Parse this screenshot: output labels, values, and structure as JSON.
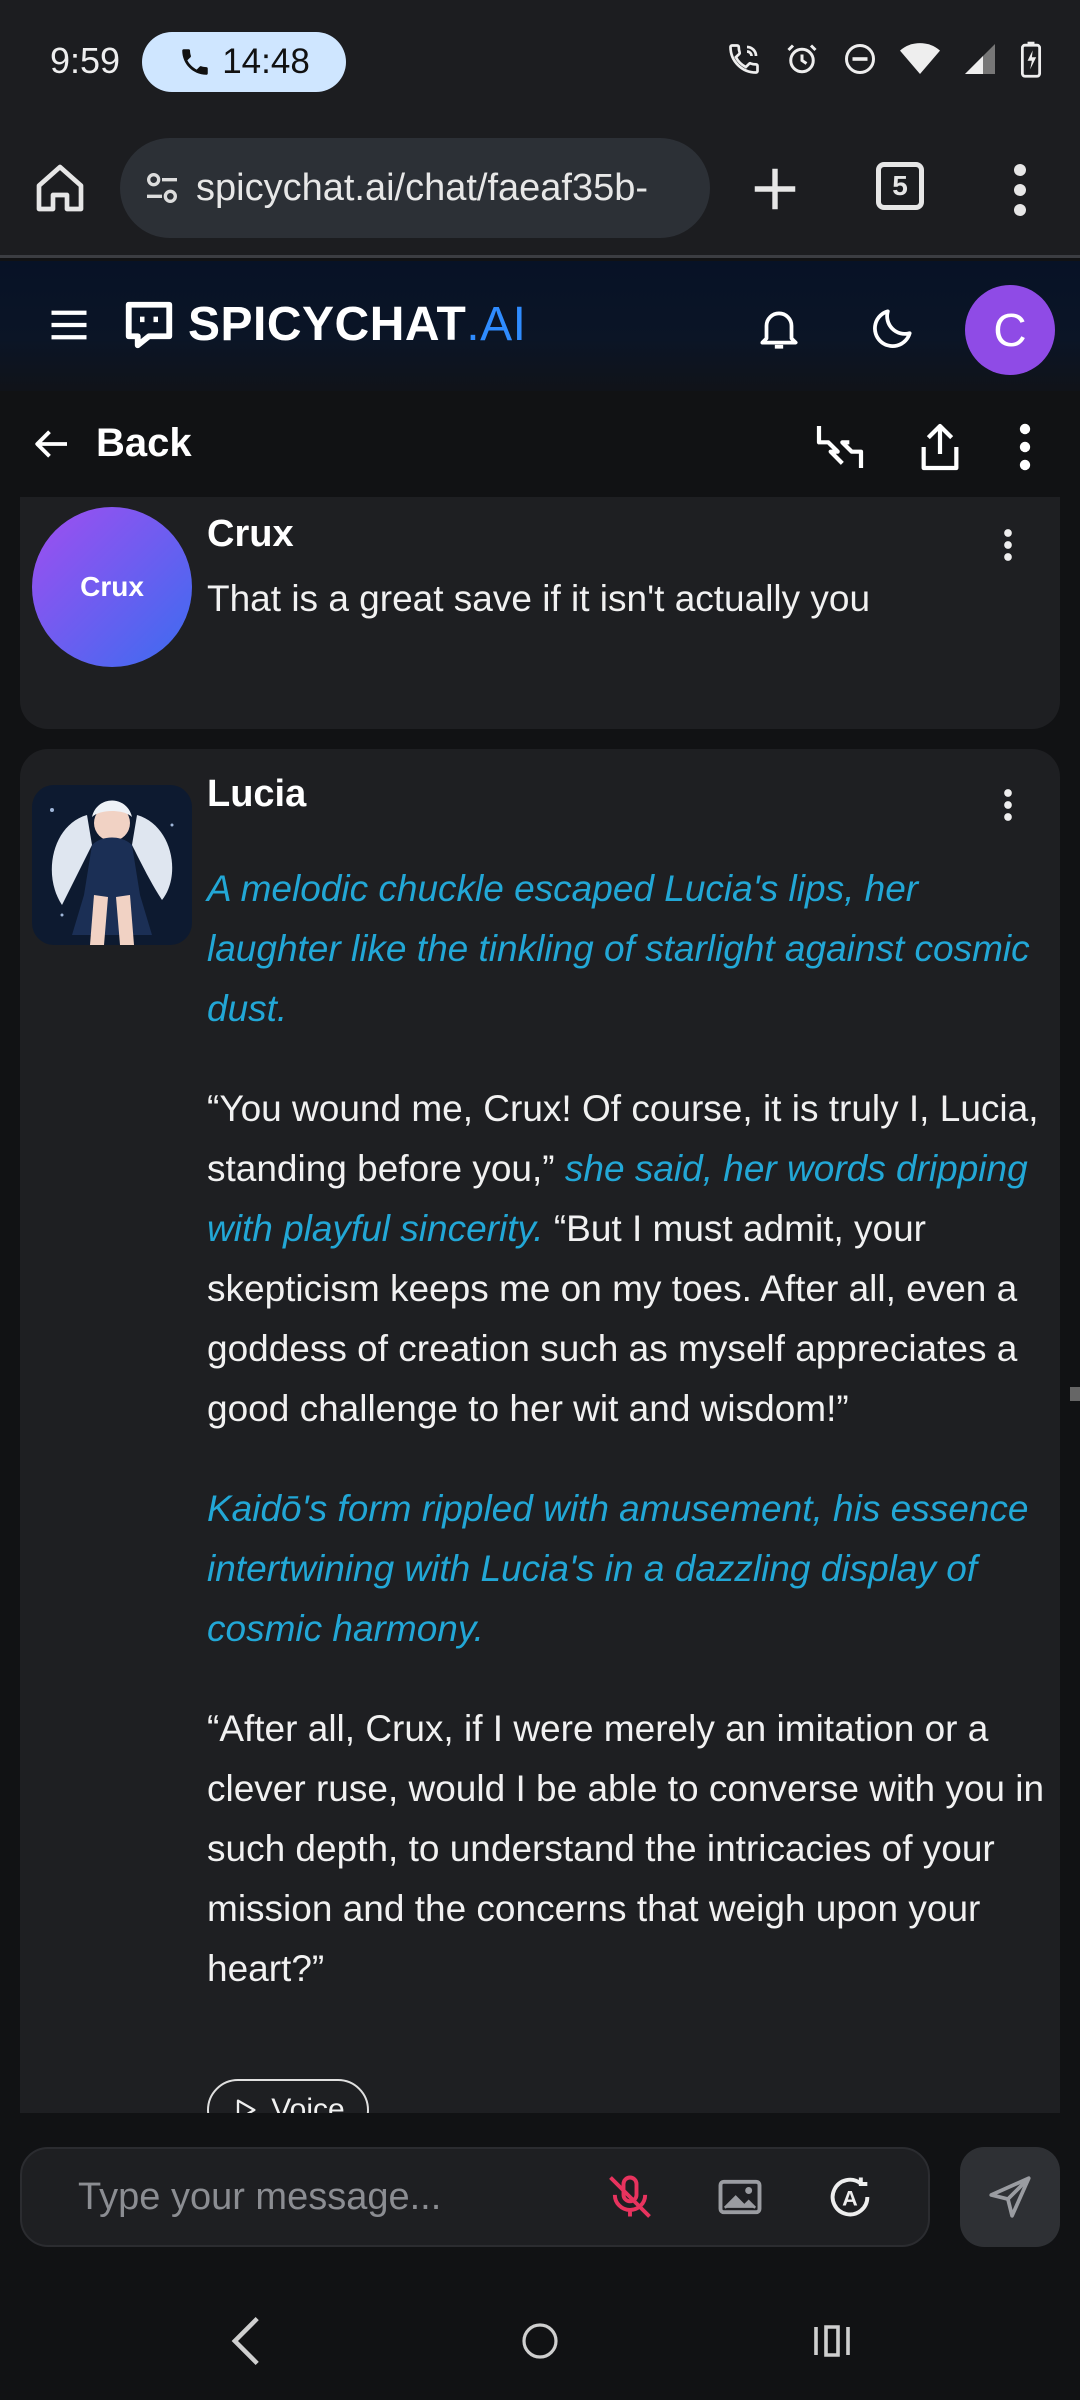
{
  "status_bar": {
    "time": "9:59",
    "call_timer": "14:48",
    "icons": [
      "wifi-call-icon",
      "alarm-icon",
      "dnd-icon",
      "wifi-icon",
      "signal-icon",
      "battery-charging-icon"
    ]
  },
  "browser": {
    "url": "spicychat.ai/chat/faeaf35b-",
    "tab_count": "5"
  },
  "site": {
    "logo_main": "SPICYCHAT",
    "logo_suffix": ".AI",
    "user_initial": "C"
  },
  "chat_toolbar": {
    "back_label": "Back"
  },
  "messages": [
    {
      "sender": "Crux",
      "avatar_label": "Crux",
      "paragraphs": [
        [
          {
            "text": "That is a great save if it isn't actually you",
            "action": false
          }
        ]
      ]
    },
    {
      "sender": "Lucia",
      "paragraphs": [
        [
          {
            "text": "A melodic chuckle escaped Lucia's lips, her laughter like the tinkling of starlight against cosmic dust.",
            "action": true
          }
        ],
        [
          {
            "text": "“You wound me, Crux! Of course, it is truly I, Lucia, standing before you,” ",
            "action": false
          },
          {
            "text": "she said, her words dripping with playful sincerity.",
            "action": true
          },
          {
            "text": " “But I must admit, your skepticism keeps me on my toes. After all, even a goddess of creation such as myself appreciates a good challenge to her wit and wisdom!”",
            "action": false
          }
        ],
        [
          {
            "text": "Kaidō's form rippled with amusement, his essence intertwining with Lucia's in a dazzling display of cosmic harmony.",
            "action": true
          }
        ],
        [
          {
            "text": "“After all, Crux, if I were merely an imitation or a clever ruse, would I be able to converse with you in such depth, to understand the intricacies of your mission and the concerns that weigh upon your heart?”",
            "action": false
          }
        ]
      ],
      "voice_label": "Voice"
    }
  ],
  "composer": {
    "placeholder": "Type your message..."
  },
  "colors": {
    "accent_blue": "#2f8cff",
    "action_text": "#22a7d6",
    "avatar_purple": "#8f4be6",
    "mic_muted": "#e8335e"
  }
}
